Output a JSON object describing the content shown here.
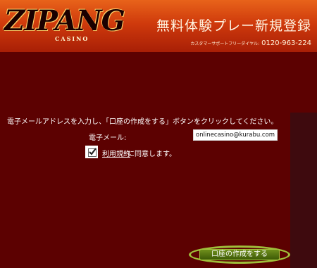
{
  "header": {
    "logo_text": "ZIPANG",
    "logo_sub": "CASINO",
    "title": "無料体験プレー新規登録",
    "support_label": "カスタマーサポートフリーダイヤル:",
    "support_phone": "0120-963-224"
  },
  "form": {
    "instruction": "電子メールアドレスを入力し、「口座の作成をする」ボタンをクリックしてください。",
    "email_label": "電子メール:",
    "email_value": "onlinecasino@kurabu.com",
    "terms_checked": true,
    "terms_link": "利用規約",
    "terms_suffix": "に同意します。",
    "submit_label": "口座の作成をする"
  },
  "colors": {
    "background": "#5c0101",
    "header_accent": "#cf3a0c",
    "button_green": "#4e6e10",
    "highlight_ring": "#9fbe3a"
  }
}
